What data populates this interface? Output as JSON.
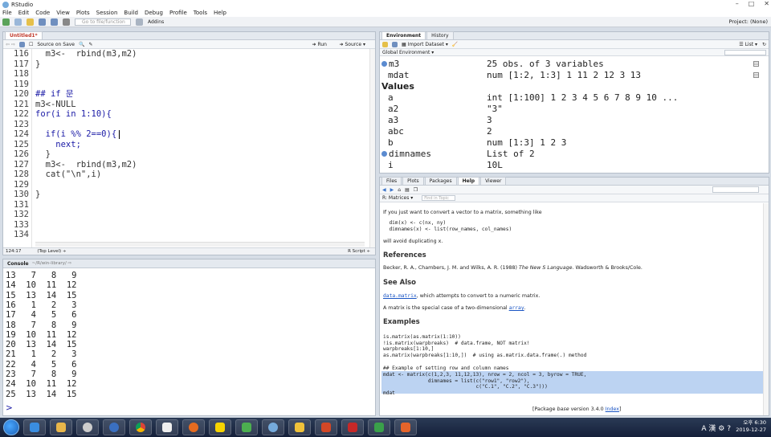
{
  "window": {
    "title": "RStudio",
    "project": "Project: (None)"
  },
  "menu": [
    "File",
    "Edit",
    "Code",
    "View",
    "Plots",
    "Session",
    "Build",
    "Debug",
    "Profile",
    "Tools",
    "Help"
  ],
  "toolbar": {
    "goto_placeholder": "Go to file/function",
    "addins": "Addins"
  },
  "editor": {
    "tab": "Untitled1*",
    "source_on_save": "Source on Save",
    "run": "Run",
    "source": "Source",
    "lines": [
      {
        "n": "116",
        "t": "  m3<-  rbind(m3,m2)"
      },
      {
        "n": "117",
        "t": "}"
      },
      {
        "n": "118",
        "t": ""
      },
      {
        "n": "119",
        "t": ""
      },
      {
        "n": "120",
        "t": "## if 문"
      },
      {
        "n": "121",
        "t": "m3<-NULL"
      },
      {
        "n": "122",
        "t": "for(i in 1:10){"
      },
      {
        "n": "123",
        "t": ""
      },
      {
        "n": "124",
        "t": "  if(i %% 2==0){"
      },
      {
        "n": "125",
        "t": "    next;"
      },
      {
        "n": "126",
        "t": "  }"
      },
      {
        "n": "127",
        "t": "  m3<-  rbind(m3,m2)"
      },
      {
        "n": "128",
        "t": "  cat(\"\\n\",i)"
      },
      {
        "n": "129",
        "t": ""
      },
      {
        "n": "130",
        "t": "}"
      },
      {
        "n": "131",
        "t": ""
      },
      {
        "n": "132",
        "t": ""
      },
      {
        "n": "133",
        "t": ""
      },
      {
        "n": "134",
        "t": ""
      }
    ],
    "status_pos": "124:17",
    "status_scope": "(Top Level) ÷",
    "status_type": "R Script ÷"
  },
  "console": {
    "tab": "Console",
    "path": "~/R/win-library/ ⇨",
    "lines": [
      "13   7   8   9",
      "14  10  11  12",
      "15  13  14  15",
      "16   1   2   3",
      "17   4   5   6",
      "18   7   8   9",
      "19  10  11  12",
      "20  13  14  15",
      "21   1   2   3",
      "22   4   5   6",
      "23   7   8   9",
      "24  10  11  12",
      "25  13  14  15"
    ],
    "prompt": ">"
  },
  "environment": {
    "tabs": [
      "Environment",
      "History"
    ],
    "import": "Import Dataset",
    "list": "List",
    "scope": "Global Environment",
    "rows": [
      {
        "name": "m3",
        "value": "25 obs. of 3 variables",
        "expand": true,
        "grid": true
      },
      {
        "name": "mdat",
        "value": "num [1:2, 1:3] 1 11 2 12 3 13",
        "grid": true
      },
      {
        "name": "Values",
        "value": "",
        "section": true
      },
      {
        "name": "a",
        "value": "int [1:100] 1 2 3 4 5 6 7 8 9 10 ..."
      },
      {
        "name": "a2",
        "value": "\"3\""
      },
      {
        "name": "a3",
        "value": "3"
      },
      {
        "name": "abc",
        "value": "2"
      },
      {
        "name": "b",
        "value": "num [1:3] 1 2 3"
      },
      {
        "name": "dimnames",
        "value": "List of 2",
        "expand": true
      },
      {
        "name": "i",
        "value": "10L"
      }
    ]
  },
  "help": {
    "tabs": [
      "Files",
      "Plots",
      "Packages",
      "Help",
      "Viewer"
    ],
    "topic": "R: Matrices ▾",
    "find_placeholder": "Find in Topic",
    "intro": "If you just want to convert a vector to a matrix, something like",
    "code1": "  dim(x) <- c(nx, ny)\n  dimnames(x) <- list(row_names, col_names)",
    "avoid": "will avoid duplicating x.",
    "references_h": "References",
    "ref_pre": "Becker, R. A., Chambers, J. M. and Wilks, A. R. (1988) ",
    "ref_italic": "The New S Language",
    "ref_post": ". Wadsworth & Brooks/Cole.",
    "seealso_h": "See Also",
    "seealso_link": "data.matrix",
    "seealso_text": ", which attempts to convert to a numeric matrix.",
    "special_pre": "A matrix is the special case of a two-dimensional ",
    "special_link": "array",
    "special_post": ".",
    "examples_h": "Examples",
    "code2": "is.matrix(as.matrix(1:10))\n!is.matrix(warpbreaks)  # data.frame, NOT matrix!\nwarpbreaks[1:10,]\nas.matrix(warpbreaks[1:10,])  # using as.matrix.data.frame(.) method",
    "code3": "## Example of setting row and column names",
    "code4": "mdat <- matrix(c(1,2,3, 11,12,13), nrow = 2, ncol = 3, byrow = TRUE,\n               dimnames = list(c(\"row1\", \"row2\"),\n                               c(\"C.1\", \"C.2\", \"C.3\")))\nmdat",
    "footer_pre": "[Package ",
    "footer_italic": "base",
    "footer_mid": " version 3.4.0 ",
    "footer_link": "Index",
    "footer_post": "]"
  },
  "taskbar": {
    "ime": "A 漢 ⚙ ?",
    "time": "오후 6:30",
    "date": "2019-12-27"
  }
}
